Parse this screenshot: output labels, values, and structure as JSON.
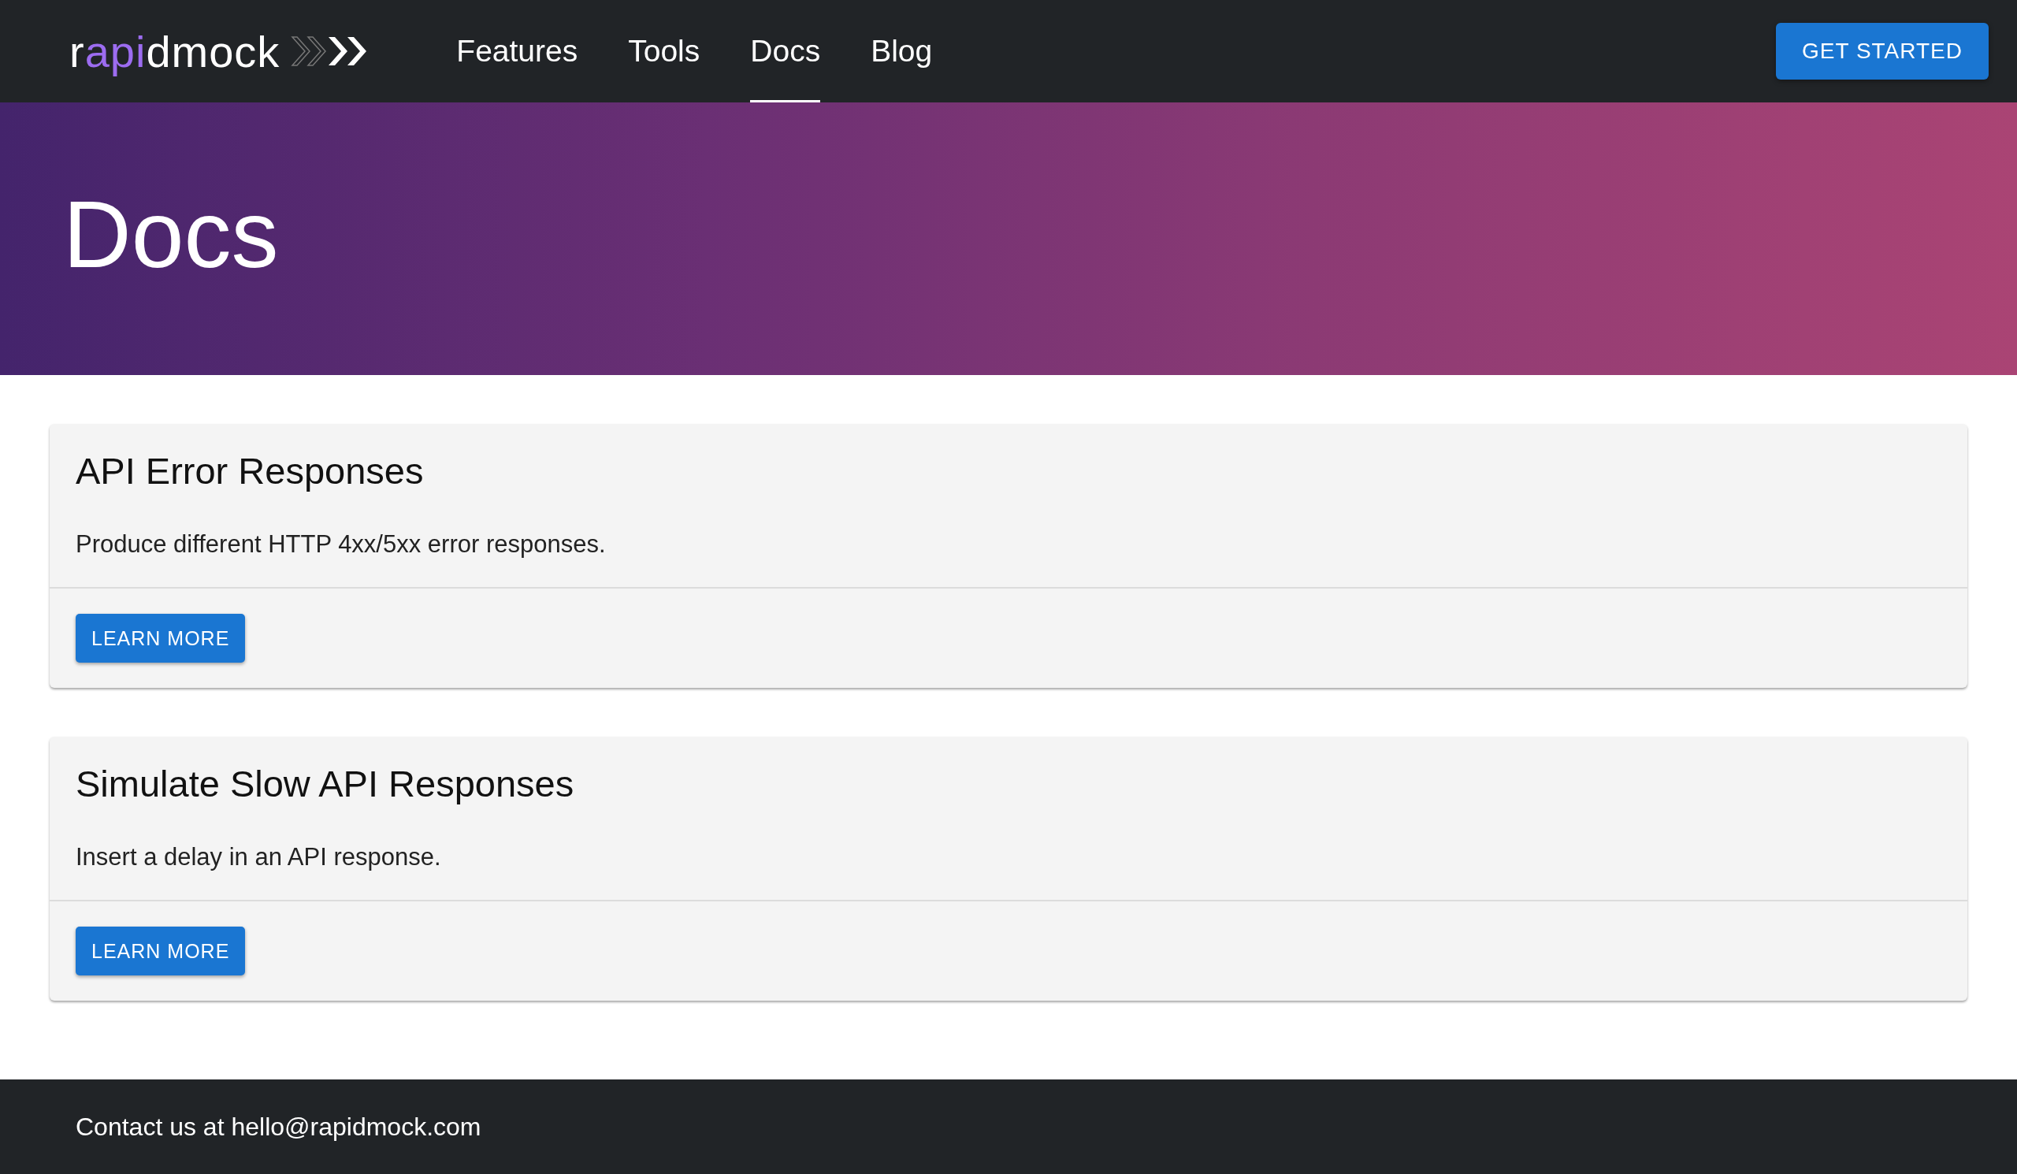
{
  "header": {
    "logo": [
      {
        "text": "r",
        "accent": false
      },
      {
        "text": "api",
        "accent": true
      },
      {
        "text": "dmock",
        "accent": false
      }
    ],
    "nav": [
      {
        "label": "Features",
        "selected": false
      },
      {
        "label": "Tools",
        "selected": false
      },
      {
        "label": "Docs",
        "selected": true
      },
      {
        "label": "Blog",
        "selected": false
      }
    ],
    "cta": "GET STARTED"
  },
  "hero": {
    "title": "Docs"
  },
  "cards": [
    {
      "title": "API Error Responses",
      "description": "Produce different HTTP 4xx/5xx error responses.",
      "button": "LEARN MORE"
    },
    {
      "title": "Simulate Slow API Responses",
      "description": "Insert a delay in an API response.",
      "button": "LEARN MORE"
    }
  ],
  "footer": {
    "text": "Contact us at hello@rapidmock.com"
  }
}
